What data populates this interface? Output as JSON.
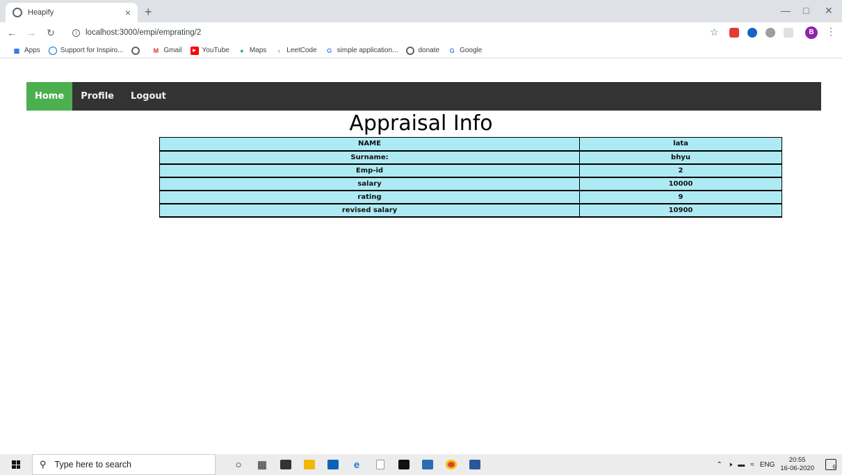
{
  "browser": {
    "tab_title": "Heapify",
    "tab_close": "×",
    "new_tab": "+",
    "url": "localhost:3000/empi/emprating/2",
    "bookmarks": [
      {
        "label": "Apps",
        "icon": "apps-grid-icon",
        "color": "#1a73e8"
      },
      {
        "label": "Support for Inspiro...",
        "icon": "dell-icon",
        "color": "#0076ce"
      },
      {
        "label": "",
        "icon": "globe-icon",
        "color": "#5f6368"
      },
      {
        "label": "Gmail",
        "icon": "gmail-icon",
        "color": "#d93025"
      },
      {
        "label": "YouTube",
        "icon": "youtube-icon",
        "color": "#ff0000"
      },
      {
        "label": "Maps",
        "icon": "maps-pin-icon",
        "color": "#fbbc04"
      },
      {
        "label": "LeetCode",
        "icon": "leetcode-icon",
        "color": "#888888"
      },
      {
        "label": "simple application...",
        "icon": "google-g-icon",
        "color": "#4285f4"
      },
      {
        "label": "donate",
        "icon": "globe-icon",
        "color": "#5f6368"
      },
      {
        "label": "Google",
        "icon": "google-g-icon",
        "color": "#4285f4"
      }
    ],
    "profile_initial": "B"
  },
  "nav": {
    "home": "Home",
    "profile": "Profile",
    "logout": "Logout",
    "active_color": "#4caf50",
    "bar_color": "#333333"
  },
  "page": {
    "title": "Appraisal Info",
    "table_bg": "#aeeaf3",
    "rows": [
      {
        "label": "NAME",
        "value": "lata"
      },
      {
        "label": "Surname:",
        "value": "bhyu"
      },
      {
        "label": "Emp-id",
        "value": "2"
      },
      {
        "label": "salary",
        "value": "10000"
      },
      {
        "label": "rating",
        "value": "9"
      },
      {
        "label": "revised salary",
        "value": "10900"
      }
    ]
  },
  "taskbar": {
    "search_placeholder": "Type here to search",
    "language": "ENG",
    "time": "20:55",
    "date": "16-06-2020",
    "notification_count": "6"
  }
}
